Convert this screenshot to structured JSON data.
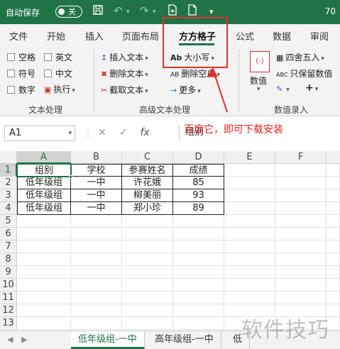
{
  "titlebar": {
    "autosave_label": "自动保存",
    "toggle_label": "关",
    "doc_name": "70"
  },
  "tabs": [
    "文件",
    "开始",
    "插入",
    "页面布局",
    "方方格子",
    "公式",
    "数据",
    "审阅"
  ],
  "ribbon": {
    "text_group": {
      "label": "文本处理",
      "checkboxes": [
        "空格",
        "英文",
        "符号",
        "中文",
        "数字"
      ],
      "exec_label": "执行"
    },
    "advanced_group": {
      "label": "高级文本处理",
      "insert_text": "插入文本",
      "delete_text": "删除文本",
      "trim_text": "截取文本",
      "case_label": "大小写",
      "delete_blank": "删除空白",
      "more_label": "更多"
    },
    "number_group": {
      "label": "数值录入",
      "number_label": "数值",
      "round_label": "四舍五入",
      "keep_value": "只保留数值"
    }
  },
  "annotation": "百度它，即可下载安装",
  "formula_bar": {
    "name_box": "A1",
    "content": "组别"
  },
  "sheet": {
    "columns": [
      "A",
      "B",
      "C",
      "D",
      "E",
      "F"
    ],
    "rows": [
      "1",
      "2",
      "3",
      "4",
      "5",
      "6",
      "7",
      "8",
      "9",
      "10",
      "11",
      "12",
      "13"
    ],
    "headers": [
      "组别",
      "学校",
      "参赛姓名",
      "成绩"
    ],
    "data": [
      [
        "低年级组",
        "一中",
        "许花娥",
        "85"
      ],
      [
        "低年级组",
        "一中",
        "柳美丽",
        "93"
      ],
      [
        "低年级组",
        "一中",
        "郑小珍",
        "89"
      ]
    ]
  },
  "sheet_tabs": [
    "低年级组-一中",
    "高年级组-一中",
    "低"
  ],
  "watermark": "软件技巧",
  "colors": {
    "accent": "#217346",
    "annotation": "#e03030"
  }
}
